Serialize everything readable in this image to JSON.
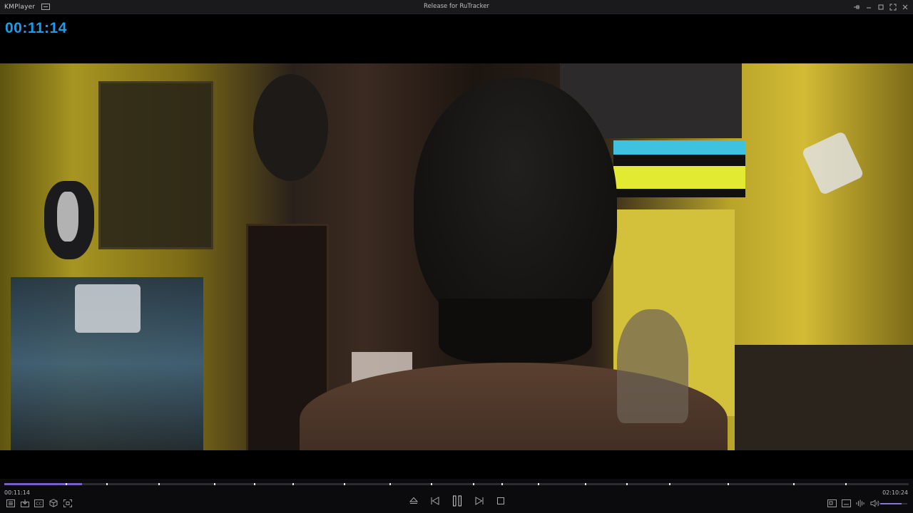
{
  "app": {
    "brand": "KMPlayer",
    "window_title": "Release for RuTracker"
  },
  "osd": {
    "time": "00:11:14"
  },
  "player": {
    "current_time": "00:11:14",
    "total_time": "02:10:24",
    "progress_fraction": 0.086,
    "chapter_fractions": [
      0.068,
      0.113,
      0.17,
      0.232,
      0.276,
      0.319,
      0.375,
      0.426,
      0.472,
      0.518,
      0.55,
      0.59,
      0.642,
      0.688,
      0.735,
      0.8,
      0.872,
      0.93
    ],
    "volume_fraction": 0.8
  },
  "colors": {
    "accent": "#7a5ec8",
    "osd_time": "#1e9be6"
  },
  "icons": {
    "left": [
      "playlist-icon",
      "capture-icon",
      "subtitle-icon",
      "3d-icon",
      "fullscreen-icon"
    ],
    "center": [
      "eject-icon",
      "previous-icon",
      "pause-icon",
      "next-icon",
      "stop-icon"
    ],
    "right": [
      "video-settings-icon",
      "subtitles-toggle-icon",
      "audio-equalizer-icon",
      "volume-icon"
    ]
  }
}
